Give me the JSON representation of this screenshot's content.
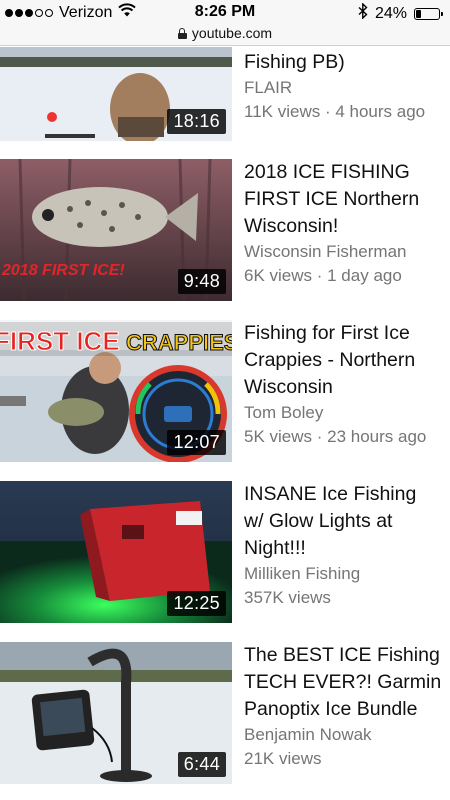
{
  "status_bar": {
    "carrier": "Verizon",
    "time": "8:26 PM",
    "battery_percent": "24%",
    "battery_level": 0.24,
    "signal_bars_filled": 3,
    "signal_bars_total": 5,
    "icons": [
      "wifi-icon",
      "bluetooth-icon",
      "battery-icon"
    ]
  },
  "browser": {
    "url": "youtube.com",
    "icons": [
      "lock-icon"
    ]
  },
  "videos": [
    {
      "title": "Fishing PB)",
      "channel": "FLAIR",
      "meta": "11K views · 4 hours ago",
      "duration": "18:16"
    },
    {
      "title": "2018 ICE FISHING\nFIRST ICE Northern\nWisconsin!",
      "channel": "Wisconsin Fisherman",
      "meta": "6K views · 1 day ago",
      "duration": "9:48",
      "thumbnail_text": "2018 FIRST ICE!"
    },
    {
      "title": "Fishing for First Ice\nCrappies - Northern\nWisconsin",
      "channel": "Tom Boley",
      "meta": "5K views · 23 hours ago",
      "duration": "12:07",
      "thumbnail_text": [
        "FIRST ICE",
        "CRAPPIES"
      ]
    },
    {
      "title": "INSANE Ice Fishing\nw/ Glow Lights at\nNight!!!",
      "channel": "Milliken Fishing",
      "meta": "357K views",
      "duration": "12:25"
    },
    {
      "title": "The BEST ICE Fishing\nTECH EVER?! Garmin\nPanoptix Ice Bundle",
      "channel": "Benjamin Nowak",
      "meta": "21K views",
      "duration": "6:44"
    }
  ]
}
